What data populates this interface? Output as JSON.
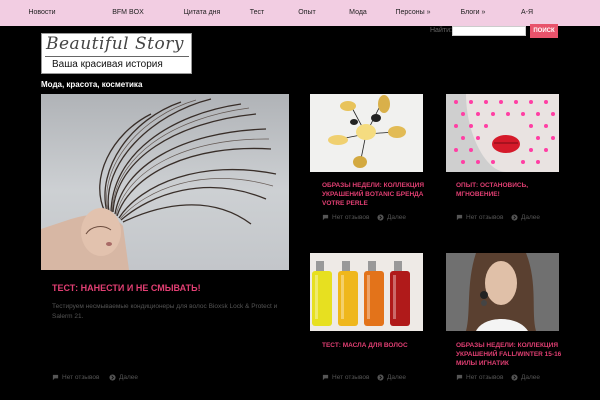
{
  "nav": {
    "items": [
      "Новости",
      "BFM BOX",
      "Цитата дня",
      "Тест",
      "Опыт",
      "Мода",
      "Персоны »",
      "Блоги »",
      "А-Я"
    ]
  },
  "search": {
    "label": "Найти:",
    "value": "",
    "button": "ПОИСК"
  },
  "logo": {
    "script": "Beautiful Story",
    "subtitle": "Ваша красивая история"
  },
  "tagline": "Мода, красота, косметика",
  "hero": {
    "title": "ТЕСТ: НАНЕСТИ И НЕ СМЫВАТЬ!",
    "excerpt": "Тестируем несмываемые кондиционеры для волос Bioxsk Lock & Protect и Salerm 21.",
    "comments": "Нет отзывов",
    "more": "Далее"
  },
  "cards": [
    {
      "title": "ОБРАЗЫ НЕДЕЛИ: КОЛЛЕКЦИЯ УКРАШЕНИЙ BOTANIC БРЕНДА VOTRE PERLE",
      "comments": "Нет отзывов",
      "more": "Далее"
    },
    {
      "title": "ОПЫТ: ОСТАНОВИСЬ, МГНОВЕНИЕ!",
      "comments": "Нет отзывов",
      "more": "Далее"
    },
    {
      "title": "ТЕСТ: МАСЛА ДЛЯ ВОЛОС",
      "comments": "Нет отзывов",
      "more": "Далее"
    },
    {
      "title": "ОБРАЗЫ НЕДЕЛИ: КОЛЛЕКЦИЯ УКРАШЕНИЙ FALL/WINTER 15-16 МИЛЫ ИГНАТИК",
      "comments": "Нет отзывов",
      "more": "Далее"
    }
  ],
  "colors": {
    "nav_bg": "#f2cde2",
    "accent": "#e23f73",
    "button": "#e8526b",
    "background": "#000000"
  }
}
